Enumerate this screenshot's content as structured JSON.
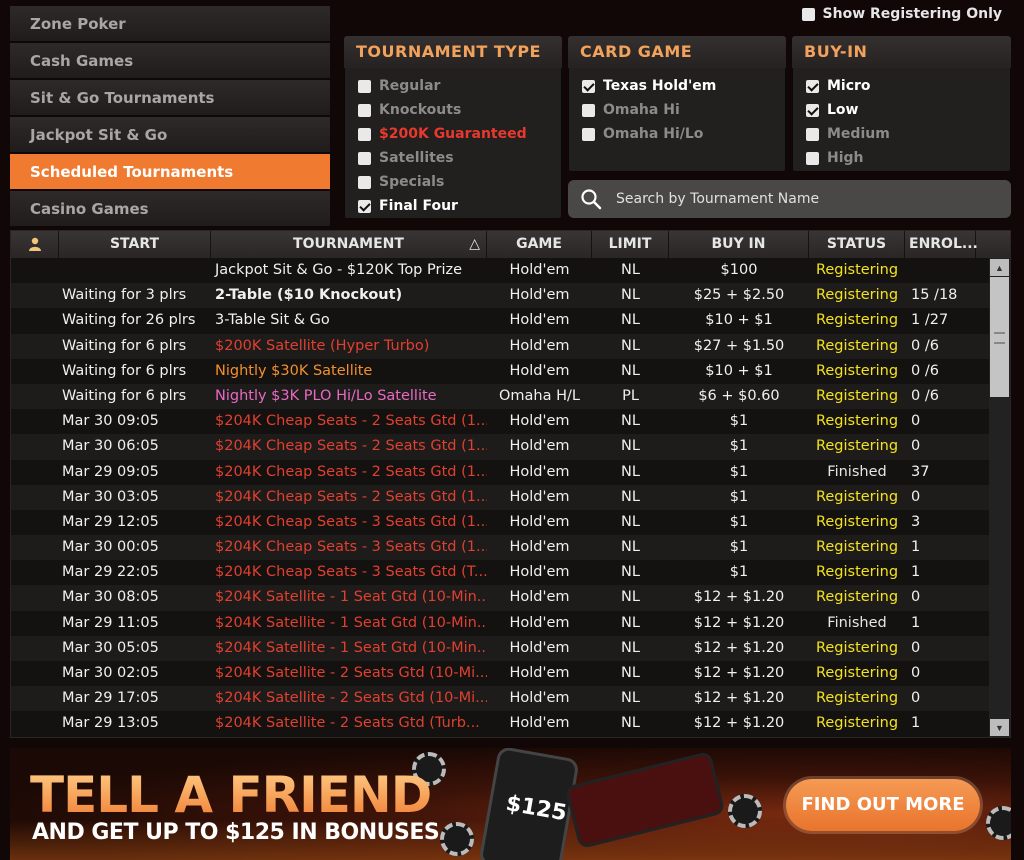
{
  "sidebar": {
    "items": [
      {
        "label": "Zone Poker"
      },
      {
        "label": "Cash Games"
      },
      {
        "label": "Sit & Go Tournaments"
      },
      {
        "label": "Jackpot Sit & Go"
      },
      {
        "label": "Scheduled Tournaments"
      },
      {
        "label": "Casino Games"
      }
    ],
    "active_index": 4
  },
  "show_registering": {
    "label": "Show Registering Only",
    "checked": false
  },
  "filters": {
    "tournament_type": {
      "title": "TOURNAMENT TYPE",
      "options": [
        {
          "label": "Regular",
          "checked": false
        },
        {
          "label": "Knockouts",
          "checked": false
        },
        {
          "label": "$200K Guaranteed",
          "checked": false
        },
        {
          "label": "Satellites",
          "checked": false
        },
        {
          "label": "Specials",
          "checked": false
        },
        {
          "label": "Final Four",
          "checked": true
        }
      ]
    },
    "card_game": {
      "title": "CARD GAME",
      "options": [
        {
          "label": "Texas Hold'em",
          "checked": true
        },
        {
          "label": "Omaha Hi",
          "checked": false
        },
        {
          "label": "Omaha Hi/Lo",
          "checked": false
        }
      ]
    },
    "buy_in": {
      "title": "BUY-IN",
      "options": [
        {
          "label": "Micro",
          "checked": true
        },
        {
          "label": "Low",
          "checked": true
        },
        {
          "label": "Medium",
          "checked": false
        },
        {
          "label": "High",
          "checked": false
        }
      ]
    }
  },
  "search": {
    "placeholder": "Search by Tournament Name",
    "icon": "search-icon"
  },
  "table": {
    "columns": [
      "START",
      "TOURNAMENT",
      "GAME",
      "LIMIT",
      "BUY IN",
      "STATUS",
      "ENROL..."
    ],
    "sort_column": "TOURNAMENT",
    "sort_icon": "△",
    "rows": [
      {
        "start": "",
        "tournament": "Jackpot Sit & Go - $120K Top Prize",
        "style": "plain",
        "game": "Hold'em",
        "limit": "NL",
        "buy_in": "$100",
        "status": "Registering",
        "enrolled": ""
      },
      {
        "start": "Waiting for 3 plrs",
        "tournament": "2-Table ($10 Knockout)",
        "style": "bold",
        "game": "Hold'em",
        "limit": "NL",
        "buy_in": "$25 + $2.50",
        "status": "Registering",
        "enrolled": "15 /18"
      },
      {
        "start": "Waiting for 26 plrs",
        "tournament": "3-Table Sit & Go",
        "style": "plain",
        "game": "Hold'em",
        "limit": "NL",
        "buy_in": "$10 + $1",
        "status": "Registering",
        "enrolled": "1 /27"
      },
      {
        "start": "Waiting for 6 plrs",
        "tournament": "$200K Satellite (Hyper Turbo)",
        "style": "red",
        "game": "Hold'em",
        "limit": "NL",
        "buy_in": "$27 + $1.50",
        "status": "Registering",
        "enrolled": "0 /6"
      },
      {
        "start": "Waiting for 6 plrs",
        "tournament": "Nightly $30K Satellite",
        "style": "orange",
        "game": "Hold'em",
        "limit": "NL",
        "buy_in": "$10 + $1",
        "status": "Registering",
        "enrolled": "0 /6"
      },
      {
        "start": "Waiting for 6 plrs",
        "tournament": "Nightly $3K PLO Hi/Lo Satellite",
        "style": "pink",
        "game": "Omaha H/L",
        "limit": "PL",
        "buy_in": "$6 + $0.60",
        "status": "Registering",
        "enrolled": "0 /6"
      },
      {
        "start": "Mar 30 09:05",
        "tournament": "$204K Cheap Seats - 2 Seats Gtd (1...",
        "style": "red",
        "game": "Hold'em",
        "limit": "NL",
        "buy_in": "$1",
        "status": "Registering",
        "enrolled": "0"
      },
      {
        "start": "Mar 30 06:05",
        "tournament": "$204K Cheap Seats - 2 Seats Gtd (1...",
        "style": "red",
        "game": "Hold'em",
        "limit": "NL",
        "buy_in": "$1",
        "status": "Registering",
        "enrolled": "0"
      },
      {
        "start": "Mar 29 09:05",
        "tournament": "$204K Cheap Seats - 2 Seats Gtd (1...",
        "style": "red",
        "game": "Hold'em",
        "limit": "NL",
        "buy_in": "$1",
        "status": "Finished",
        "enrolled": "37"
      },
      {
        "start": "Mar 30 03:05",
        "tournament": "$204K Cheap Seats - 2 Seats Gtd (1...",
        "style": "red",
        "game": "Hold'em",
        "limit": "NL",
        "buy_in": "$1",
        "status": "Registering",
        "enrolled": "0"
      },
      {
        "start": "Mar 29 12:05",
        "tournament": "$204K Cheap Seats - 3 Seats Gtd (1...",
        "style": "red",
        "game": "Hold'em",
        "limit": "NL",
        "buy_in": "$1",
        "status": "Registering",
        "enrolled": "3"
      },
      {
        "start": "Mar 30 00:05",
        "tournament": "$204K Cheap Seats - 3 Seats Gtd (1...",
        "style": "red",
        "game": "Hold'em",
        "limit": "NL",
        "buy_in": "$1",
        "status": "Registering",
        "enrolled": "1"
      },
      {
        "start": "Mar 29 22:05",
        "tournament": "$204K Cheap Seats - 3 Seats Gtd (T...",
        "style": "red",
        "game": "Hold'em",
        "limit": "NL",
        "buy_in": "$1",
        "status": "Registering",
        "enrolled": "1"
      },
      {
        "start": "Mar 30 08:05",
        "tournament": "$204K Satellite - 1 Seat Gtd (10-Min...",
        "style": "red",
        "game": "Hold'em",
        "limit": "NL",
        "buy_in": "$12 + $1.20",
        "status": "Registering",
        "enrolled": "0"
      },
      {
        "start": "Mar 29 11:05",
        "tournament": "$204K Satellite - 1 Seat Gtd (10-Min...",
        "style": "red",
        "game": "Hold'em",
        "limit": "NL",
        "buy_in": "$12 + $1.20",
        "status": "Finished",
        "enrolled": "1"
      },
      {
        "start": "Mar 30 05:05",
        "tournament": "$204K Satellite - 1 Seat Gtd (10-Min...",
        "style": "red",
        "game": "Hold'em",
        "limit": "NL",
        "buy_in": "$12 + $1.20",
        "status": "Registering",
        "enrolled": "0"
      },
      {
        "start": "Mar 30 02:05",
        "tournament": "$204K Satellite - 2 Seats Gtd (10-Mi...",
        "style": "red",
        "game": "Hold'em",
        "limit": "NL",
        "buy_in": "$12 + $1.20",
        "status": "Registering",
        "enrolled": "0"
      },
      {
        "start": "Mar 29 17:05",
        "tournament": "$204K Satellite - 2 Seats Gtd (10-Mi...",
        "style": "red",
        "game": "Hold'em",
        "limit": "NL",
        "buy_in": "$12 + $1.20",
        "status": "Registering",
        "enrolled": "0"
      },
      {
        "start": "Mar 29 13:05",
        "tournament": "$204K Satellite - 2 Seats Gtd (Turb...",
        "style": "red",
        "game": "Hold'em",
        "limit": "NL",
        "buy_in": "$12 + $1.20",
        "status": "Registering",
        "enrolled": "1"
      }
    ]
  },
  "banner": {
    "headline": "TELL A FRIEND",
    "subline": "AND GET UP TO $125 IN BONUSES",
    "phone_amount": "$125",
    "cta": "FIND OUT MORE"
  },
  "colors": {
    "accent": "#f07a2f",
    "registering": "#f3e31f",
    "red_title": "#e0402f",
    "panel_title": "#f3a25c"
  }
}
